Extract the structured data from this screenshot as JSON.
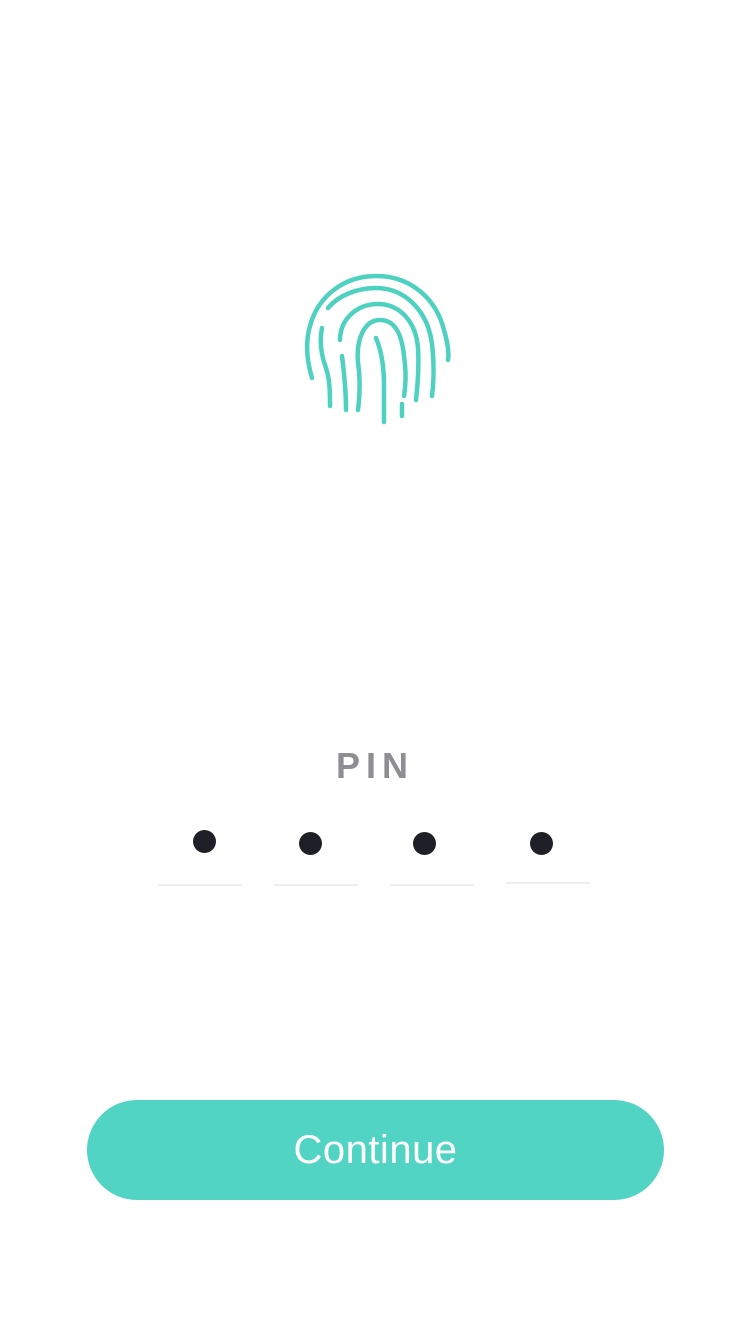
{
  "fingerprint": {
    "icon": "fingerprint-icon",
    "color": "#4fd1c1"
  },
  "pin": {
    "label": "PIN",
    "digits_entered": 4,
    "slots": [
      {
        "masked": "●"
      },
      {
        "masked": "●"
      },
      {
        "masked": "●"
      },
      {
        "masked": "●"
      }
    ]
  },
  "continue_button": {
    "label": "Continue",
    "color": "#51d4c4"
  }
}
